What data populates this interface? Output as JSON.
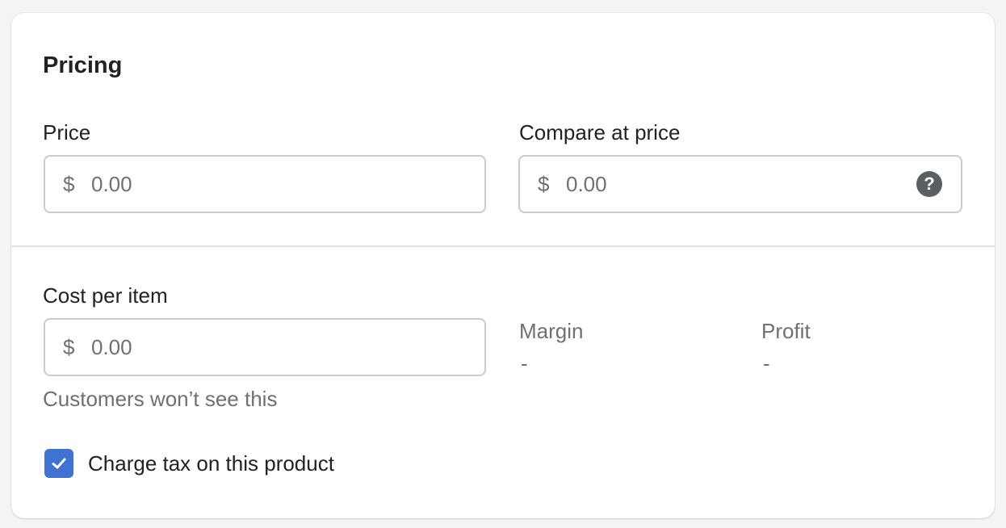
{
  "card": {
    "title": "Pricing"
  },
  "price": {
    "label": "Price",
    "prefix": "$",
    "placeholder": "0.00"
  },
  "compare_at_price": {
    "label": "Compare at price",
    "prefix": "$",
    "placeholder": "0.00",
    "help_icon": "question-circle-icon",
    "help_glyph": "?"
  },
  "cost_per_item": {
    "label": "Cost per item",
    "prefix": "$",
    "placeholder": "0.00",
    "help_text": "Customers won’t see this"
  },
  "margin": {
    "label": "Margin",
    "value": "-"
  },
  "profit": {
    "label": "Profit",
    "value": "-"
  },
  "charge_tax": {
    "label": "Charge tax on this product",
    "checked": true,
    "icon": "checkmark-icon"
  },
  "colors": {
    "checkbox_fill": "#3f72d1",
    "help_icon_fill": "#5c5f62",
    "muted_text": "#6d7175",
    "border": "#c9cccf"
  }
}
